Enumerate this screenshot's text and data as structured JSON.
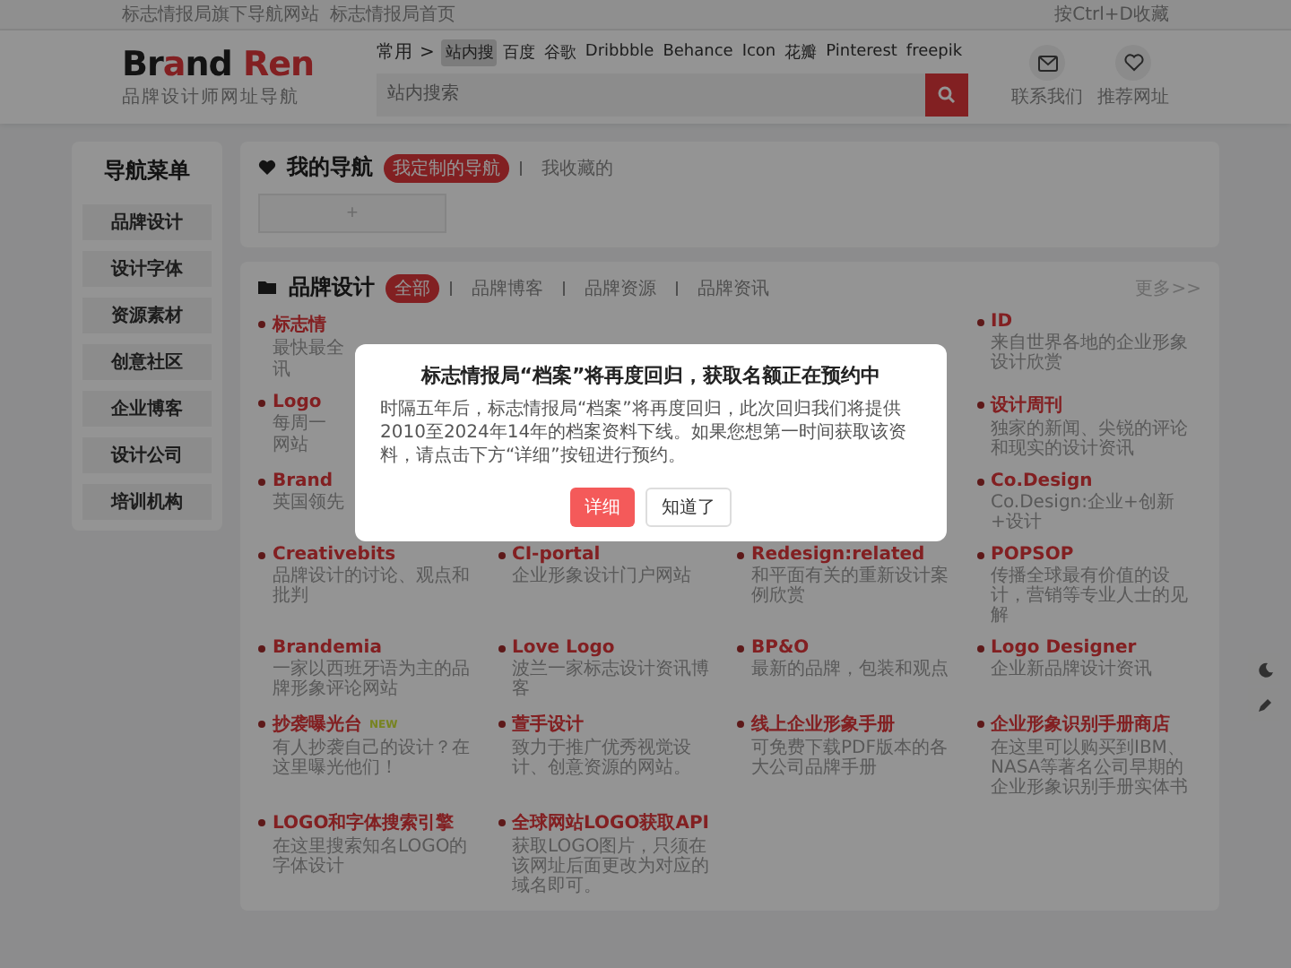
{
  "top_bar": {
    "left_links": [
      "标志情报局旗下导航网站",
      "标志情报局首页"
    ],
    "right_text": "按Ctrl+D收藏"
  },
  "header": {
    "logo": {
      "word_a": "Br",
      "word_b": "a",
      "word_d": "nd",
      "word_c": "Ren",
      "tagline": "品牌设计师网址导航"
    },
    "search_tabs": {
      "group": "常用",
      "arrow": ">",
      "items": [
        {
          "label": "站内搜",
          "selected": true
        },
        {
          "label": "百度",
          "selected": false
        },
        {
          "label": "谷歌",
          "selected": false
        },
        {
          "label": "Dribbble",
          "selected": false
        },
        {
          "label": "Behance",
          "selected": false
        },
        {
          "label": "Icon",
          "selected": false
        },
        {
          "label": "花瓣",
          "selected": false
        },
        {
          "label": "Pinterest",
          "selected": false
        },
        {
          "label": "freepik",
          "selected": false
        }
      ]
    },
    "search": {
      "placeholder": "站内搜索"
    },
    "actions": [
      {
        "kind": "mail",
        "label": "联系我们"
      },
      {
        "kind": "heart",
        "label": "推荐网址"
      }
    ]
  },
  "sidebar": {
    "title": "导航菜单",
    "items": [
      "品牌设计",
      "设计字体",
      "资源素材",
      "创意社区",
      "企业博客",
      "设计公司",
      "培训机构"
    ]
  },
  "my_nav": {
    "title": "我的导航",
    "tabs": [
      {
        "label": "我定制的导航",
        "selected": true
      },
      {
        "label": "我收藏的",
        "selected": false
      }
    ],
    "add": "+"
  },
  "brand": {
    "title": "品牌设计",
    "tabs": [
      {
        "label": "全部",
        "selected": true
      },
      {
        "label": "品牌博客",
        "selected": false
      },
      {
        "label": "品牌资源",
        "selected": false
      },
      {
        "label": "品牌资讯",
        "selected": false
      }
    ],
    "more": "更多>>",
    "rows": [
      {
        "cells": [
          {
            "kind": "cut",
            "title": "标志情",
            "lines": [
              "最快最全",
              "讯"
            ]
          },
          {
            "kind": "hidden"
          },
          {
            "kind": "hidden"
          },
          {
            "kind": "full",
            "title": "ID",
            "desc": "来自世界各地的企业形象设计欣赏"
          }
        ]
      },
      {
        "cells": [
          {
            "kind": "cut",
            "title": "Logo",
            "lines": [
              "每周一",
              "网站"
            ]
          },
          {
            "kind": "hidden"
          },
          {
            "kind": "hidden"
          },
          {
            "kind": "full",
            "title": "设计周刊",
            "desc": "独家的新闻、尖锐的评论和现实的设计资讯"
          }
        ]
      },
      {
        "cells": [
          {
            "kind": "cut",
            "title": "Brand",
            "lines": [
              "英国领先"
            ]
          },
          {
            "kind": "hidden"
          },
          {
            "kind": "hidden"
          },
          {
            "kind": "full",
            "title": "Co.Design",
            "desc": "Co.Design:企业+创新+设计"
          }
        ]
      },
      {
        "cells": [
          {
            "kind": "full",
            "title": "Creativebits",
            "desc": "品牌设计的讨论、观点和批判"
          },
          {
            "kind": "full",
            "title": "CI-portal",
            "desc": "企业形象设计门户网站"
          },
          {
            "kind": "full",
            "title": "Redesign:related",
            "desc": "和平面有关的重新设计案例欣赏"
          },
          {
            "kind": "full",
            "title": "POPSOP",
            "desc": "传播全球最有价值的设计，营销等专业人士的见解"
          }
        ]
      },
      {
        "cells": [
          {
            "kind": "full",
            "title": "Brandemia",
            "desc": "一家以西班牙语为主的品牌形象评论网站"
          },
          {
            "kind": "full",
            "title": "Love Logo",
            "desc": "波兰一家标志设计资讯博客"
          },
          {
            "kind": "full",
            "title": "BP&O",
            "desc": "最新的品牌，包装和观点"
          },
          {
            "kind": "full",
            "title": "Logo Designer",
            "desc": "企业新品牌设计资讯"
          }
        ]
      },
      {
        "cells": [
          {
            "kind": "full",
            "title": "抄袭曝光台",
            "badge": "NEW",
            "desc": "有人抄袭自己的设计？在这里曝光他们！"
          },
          {
            "kind": "full",
            "title": "萱手设计",
            "desc": "致力于推广优秀视觉设计、创意资源的网站。"
          },
          {
            "kind": "full",
            "title": "线上企业形象手册",
            "desc": "可免费下载PDF版本的各大公司品牌手册"
          },
          {
            "kind": "full",
            "title": "企业形象识别手册商店",
            "desc": "在这里可以购买到IBM、NASA等著名公司早期的企业形象识别手册实体书"
          }
        ]
      },
      {
        "cells": [
          {
            "kind": "full",
            "title": "LOGO和字体搜索引擎",
            "desc": "在这里搜索知名LOGO的字体设计"
          },
          {
            "kind": "full",
            "title": "全球网站LOGO获取API",
            "desc": "获取LOGO图片，只须在该网址后面更改为对应的域名即可。"
          }
        ]
      }
    ]
  },
  "float_buttons": [
    {
      "kind": "moon"
    },
    {
      "kind": "pen"
    }
  ],
  "modal": {
    "title": "标志情报局“档案”将再度回归，获取名额正在预约中",
    "body": "时隔五年后，标志情报局“档案”将再度回归，此次回归我们将提供2010至2024年14年的档案资料下线。如果您想第一时间获取该资料，请点击下方“详细”按钮进行预约。",
    "buttons": [
      {
        "label": "详细",
        "kind": "primary"
      },
      {
        "label": "知道了",
        "kind": "plain"
      }
    ]
  }
}
